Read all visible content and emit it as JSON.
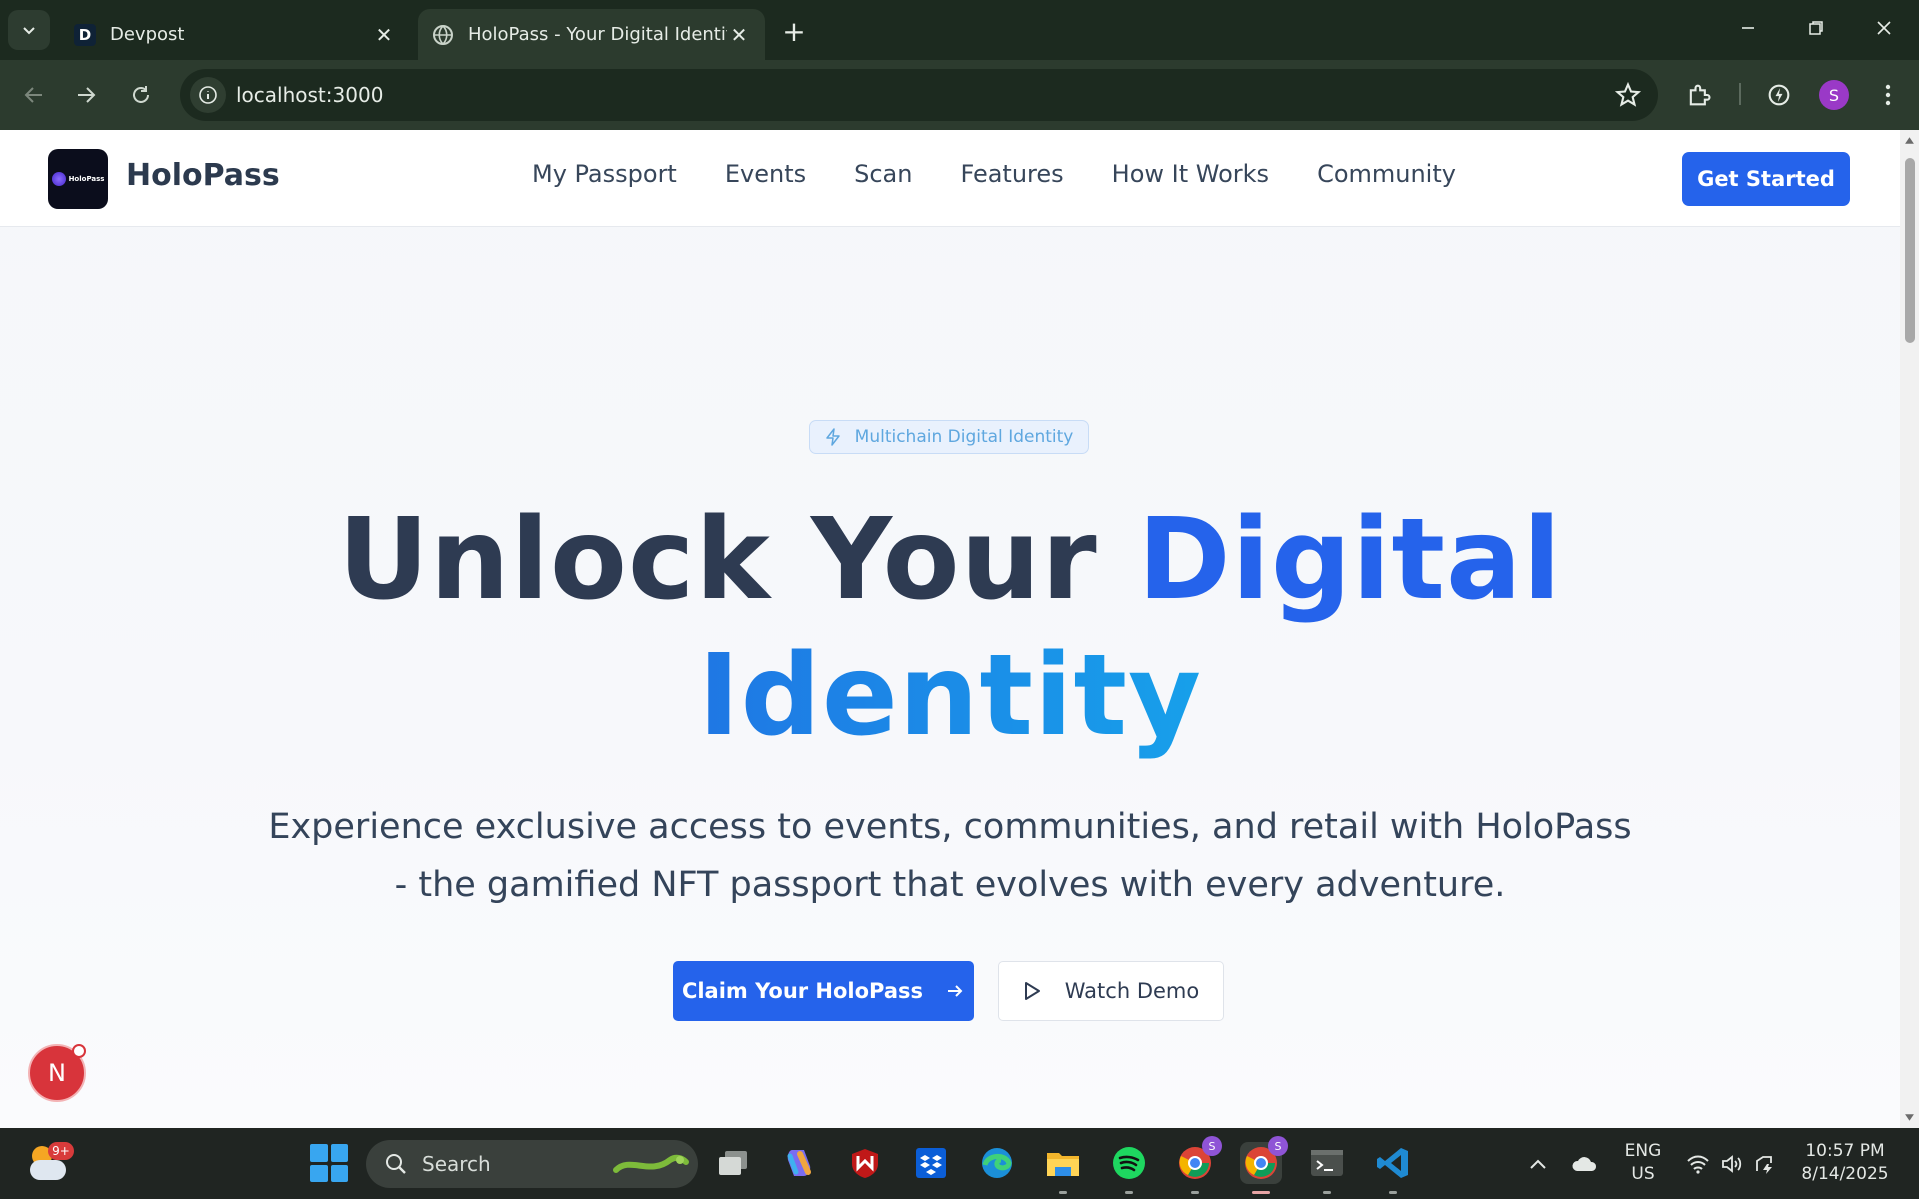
{
  "browser": {
    "tabs": [
      {
        "title": "Devpost",
        "favicon": "D"
      },
      {
        "title": "HoloPass - Your Digital Identity"
      }
    ],
    "url": "localhost:3000",
    "profile_initial": "S",
    "theme_color": "#2c3b2e"
  },
  "site": {
    "brand": "HoloPass",
    "logo_text": "HoloPass",
    "nav": [
      "My Passport",
      "Events",
      "Scan",
      "Features",
      "How It Works",
      "Community"
    ],
    "cta_label": "Get Started",
    "accent_color": "#2563eb"
  },
  "hero": {
    "badge": "Multichain Digital Identity",
    "title_part1": "Unlock Your ",
    "title_accent": "Digital",
    "title_line2": "Identity",
    "subtitle": "Experience exclusive access to events, communities, and retail with HoloPass - the gamified NFT passport that evolves with every adventure.",
    "primary_cta": "Claim Your HoloPass",
    "secondary_cta": "Watch Demo"
  },
  "dev_overlay": {
    "label": "N"
  },
  "taskbar": {
    "weather_badge": "9+",
    "search_placeholder": "Search",
    "app_badges": [
      "S",
      "S"
    ],
    "language": "ENG",
    "region": "US",
    "time": "10:57 PM",
    "date": "8/14/2025"
  }
}
